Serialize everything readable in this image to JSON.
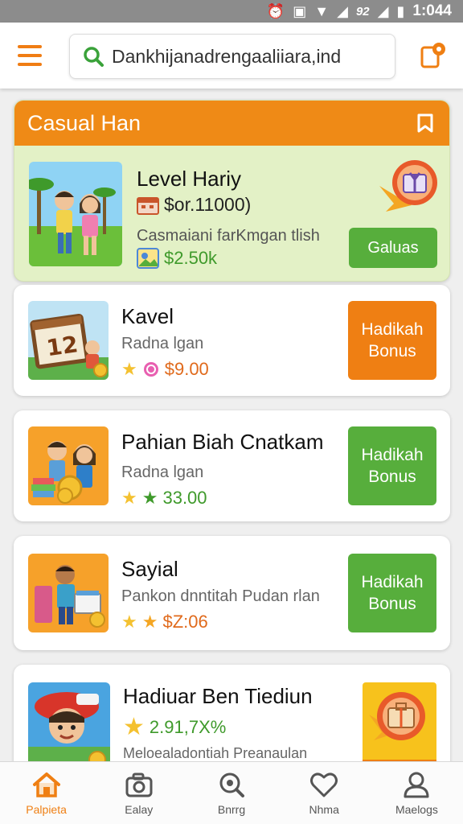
{
  "status_bar": {
    "time": "1:044",
    "battery": "92"
  },
  "header": {
    "search_value": "Dankhijanadrengaaliiara,ind"
  },
  "featured": {
    "header_title": "Casual Han",
    "title": "Level Hariy",
    "price": "$or.11000)",
    "subtitle": "Casmaiani farKmgan tlish",
    "reward": "$2.50k",
    "button_label": "Galuas"
  },
  "items": [
    {
      "title": "Kavel",
      "subtitle": "Radna lgan",
      "value": "$9.00",
      "button_label": "Hadikah Bonus",
      "button_color": "#ef7f13"
    },
    {
      "title": "Pahian Biah Cnatkam",
      "subtitle": "Radna lgan",
      "value": "33.00",
      "button_label": "Hadikah Bonus",
      "button_color": "#57ae3c"
    },
    {
      "title": "Sayial",
      "subtitle": "Pankon dnntitah Pudan rlan",
      "value": "$Z:06",
      "button_label": "Hadikah Bonus",
      "button_color": "#57ae3c"
    },
    {
      "title": "Hadiuar Ben Tiediun",
      "value": "2.91,7X%",
      "subtitle": "Meloealadontiah Preanaulan"
    }
  ],
  "bottom_nav": [
    {
      "label": "Palpieta",
      "icon": "home-icon",
      "active": true
    },
    {
      "label": "Ealay",
      "icon": "camera-icon"
    },
    {
      "label": "Bnrrg",
      "icon": "search-icon"
    },
    {
      "label": "Nhma",
      "icon": "heart-icon"
    },
    {
      "label": "Maelogs",
      "icon": "profile-icon"
    }
  ],
  "colors": {
    "accent_orange": "#ef7f13",
    "accent_green": "#57ae3c",
    "featured_bg": "#e3f1c6"
  }
}
